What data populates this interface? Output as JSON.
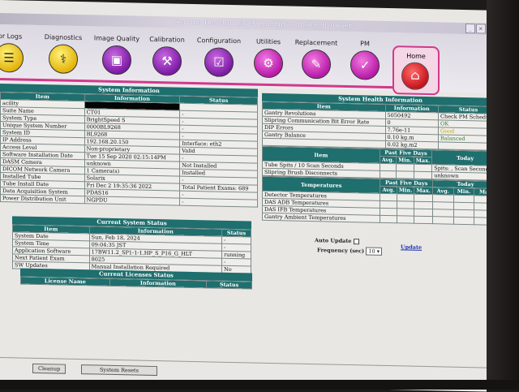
{
  "window": {
    "title": "Service Desktop UNIX machine - Insite_Browser"
  },
  "nav": [
    {
      "label": "ror Logs",
      "icon": "error-logs-icon"
    },
    {
      "label": "Diagnostics",
      "icon": "stethoscope-icon"
    },
    {
      "label": "Image Quality",
      "icon": "image-quality-icon"
    },
    {
      "label": "Calibration",
      "icon": "calibration-icon"
    },
    {
      "label": "Configuration",
      "icon": "configuration-icon"
    },
    {
      "label": "Utilities",
      "icon": "utilities-icon"
    },
    {
      "label": "Replacement",
      "icon": "replacement-icon"
    },
    {
      "label": "PM",
      "icon": "pm-icon"
    },
    {
      "label": "Home",
      "icon": "home-icon"
    }
  ],
  "system_info": {
    "title": "System Information",
    "headers": [
      "Item",
      "Information",
      "Status"
    ],
    "rows": [
      [
        "acility",
        "",
        ""
      ],
      [
        "Suite Name",
        "CT01",
        "-"
      ],
      [
        "System Type",
        "BrightSpeed S",
        "-"
      ],
      [
        "Unique System Number",
        "0000BL9268",
        "-"
      ],
      [
        "System ID",
        "BL9268",
        "-"
      ],
      [
        "IP Address",
        "192.168.20.150",
        "Interface: eth2"
      ],
      [
        "Access Level",
        "Non-proprietary",
        "Valid"
      ],
      [
        "Software Installation Date",
        "Tue 15 Sep 2020 02:15:14PM",
        "-"
      ],
      [
        "DASM Camera",
        "unknown",
        "Not Installed"
      ],
      [
        "DICOM Network Camera",
        "1 Camera(s)",
        "Installed"
      ],
      [
        "Installed Tube",
        "Solarix",
        "-"
      ],
      [
        "Tube Install Date",
        "Fri Dec 2 19:35:36 2022",
        "Total Patient Exams: 689"
      ],
      [
        "Data Acquisition System",
        "PDAS16",
        "-"
      ],
      [
        "Power Distribution Unit",
        "NGPDU",
        "-"
      ]
    ]
  },
  "current_status": {
    "title": "Current System Status",
    "headers": [
      "Item",
      "Information",
      "Status"
    ],
    "rows": [
      [
        "System Date",
        "Sun, Feb 18, 2024",
        "-"
      ],
      [
        "System Time",
        "09:04:35 JST",
        "-"
      ],
      [
        "Application Software",
        "17BW11.2_SP1-1-1.HP_S_P16_G_HLT",
        "running"
      ],
      [
        "Next Patient Exam",
        "8025",
        "-"
      ],
      [
        "SW Updates",
        "Manual Installation Required",
        "No"
      ]
    ]
  },
  "licenses": {
    "title": "Current Licenses Status",
    "headers": [
      "License Name",
      "Information",
      "Status"
    ]
  },
  "health": {
    "title": "System Health Information",
    "headers": [
      "Item",
      "Information",
      "Status"
    ],
    "rows": [
      [
        "Gantry Revolutions",
        "5050492",
        "Check PM Schedule"
      ],
      [
        "Slipring Communication Bit Error Rate",
        "0",
        "OK"
      ],
      [
        "DIP Errors",
        "7.76e-11",
        "Good"
      ],
      [
        "Gantry Balance",
        "0.10 kg.m",
        "Balanced"
      ],
      [
        "",
        "0.02 kg.m2",
        ""
      ]
    ],
    "five_days": {
      "headers": [
        "Item",
        "Past Five Days",
        "Today"
      ],
      "sub": [
        "Avg.",
        "Min.",
        "Max."
      ],
      "rows": [
        [
          "Tube Spits / 10 Scan Seconds",
          "Spits: , Scan Seconds:"
        ],
        [
          "Slipring Brush Disconnects",
          "unknown"
        ]
      ]
    },
    "temps": {
      "headers": [
        "Temperatures",
        "Past Five Days",
        "Today"
      ],
      "sub": [
        "Avg.",
        "Min.",
        "Max.",
        "Avg.",
        "Min.",
        "Max."
      ],
      "rows": [
        "Detector Temperatures",
        "DAS ADB Temperatures",
        "DAS IFB Temperatures",
        "Gantry Ambient Temperatures"
      ]
    }
  },
  "controls": {
    "auto_update": "Auto Update",
    "frequency": "Frequency (sec)",
    "frequency_value": "10",
    "update_link": "Update"
  },
  "footer": {
    "cleanup": "Cleanup",
    "resets": "System Resets"
  },
  "colors": {
    "header": "#1e6f6e",
    "accent": "#d13a8a",
    "ok": "#2e7d2e",
    "warn": "#c5a400"
  }
}
